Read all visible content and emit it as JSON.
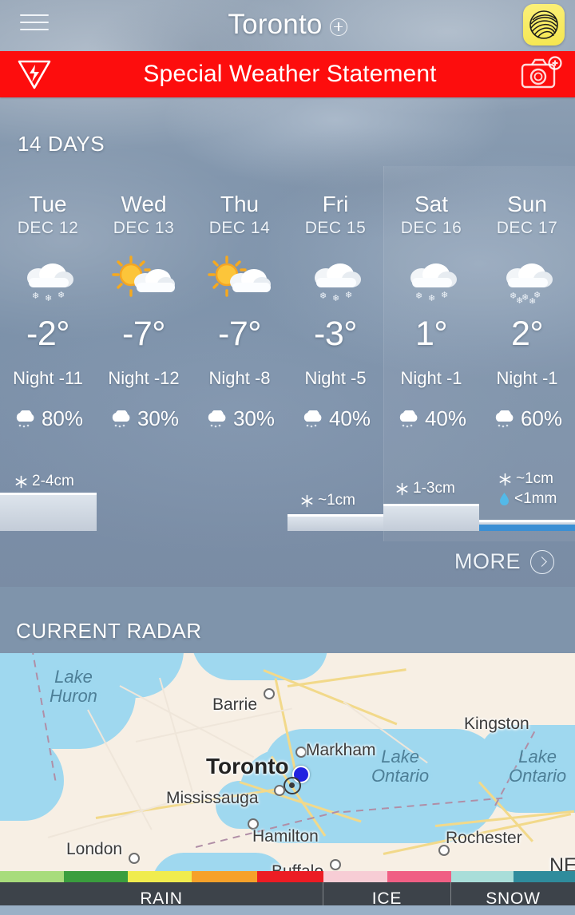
{
  "header": {
    "menu_icon": "hamburger-menu-icon",
    "city": "Toronto",
    "add_icon": "plus-circle-icon",
    "app_icon": "globe-sphere-icon"
  },
  "alert": {
    "icon": "lightning-triangle-icon",
    "text": "Special Weather Statement",
    "camera_icon": "camera-plus-icon",
    "color": "#fd0d0d"
  },
  "forecast": {
    "title": "14 DAYS",
    "more_label": "MORE",
    "more_icon": "chevron-right-circle-icon",
    "days": [
      {
        "dow": "Tue",
        "date": "DEC 12",
        "icon": "cloud-snow-icon",
        "high": "-2°",
        "night": "Night -11",
        "pop": "80%",
        "pop_icon": "cloud-drizzle-icon"
      },
      {
        "dow": "Wed",
        "date": "DEC 13",
        "icon": "sun-cloud-icon",
        "high": "-7°",
        "night": "Night -12",
        "pop": "30%",
        "pop_icon": "cloud-drizzle-icon"
      },
      {
        "dow": "Thu",
        "date": "DEC 14",
        "icon": "sun-cloud-icon",
        "high": "-7°",
        "night": "Night -8",
        "pop": "30%",
        "pop_icon": "cloud-drizzle-icon"
      },
      {
        "dow": "Fri",
        "date": "DEC 15",
        "icon": "cloud-snow-icon",
        "high": "-3°",
        "night": "Night -5",
        "pop": "40%",
        "pop_icon": "cloud-drizzle-icon"
      },
      {
        "dow": "Sat",
        "date": "DEC 16",
        "icon": "cloud-snow-icon",
        "high": "1°",
        "night": "Night -1",
        "pop": "40%",
        "pop_icon": "cloud-drizzle-icon"
      },
      {
        "dow": "Sun",
        "date": "DEC 17",
        "icon": "cloud-snow-icon",
        "high": "2°",
        "night": "Night -1",
        "pop": "60%",
        "pop_icon": "cloud-drizzle-icon"
      }
    ],
    "accumulation": [
      {
        "day_index": 0,
        "snow": "2-4cm",
        "rain": null
      },
      {
        "day_index": 3,
        "snow": "~1cm",
        "rain": null
      },
      {
        "day_index": 4,
        "snow": "1-3cm",
        "rain": null
      },
      {
        "day_index": 5,
        "snow": "~1cm",
        "rain": "<1mm"
      }
    ]
  },
  "radar": {
    "title": "CURRENT RADAR",
    "cities": [
      {
        "name": "Barrie",
        "style": "normal"
      },
      {
        "name": "Markham",
        "style": "normal"
      },
      {
        "name": "Kingston",
        "style": "normal"
      },
      {
        "name": "Toronto",
        "style": "big"
      },
      {
        "name": "Mississauga",
        "style": "normal"
      },
      {
        "name": "Hamilton",
        "style": "normal"
      },
      {
        "name": "London",
        "style": "normal"
      },
      {
        "name": "Rochester",
        "style": "normal"
      },
      {
        "name": "Buffalo",
        "style": "normal"
      },
      {
        "name": "NE",
        "style": "normal"
      }
    ],
    "lakes": [
      {
        "line1": "Lake",
        "line2": "Huron"
      },
      {
        "line1": "Lake",
        "line2": "Ontario"
      },
      {
        "line1": "Lake",
        "line2": "Ontario"
      }
    ],
    "location_marker": "current-location-dot"
  },
  "legend": {
    "cells": [
      {
        "label": "RAIN"
      },
      {
        "label": "ICE"
      },
      {
        "label": "SNOW"
      }
    ],
    "swatches": [
      "#a8dc7c",
      "#3a9e3e",
      "#f0ec4e",
      "#f6a12a",
      "#ec1c24",
      "#f7cdd5",
      "#f05f84",
      "#a9ded9",
      "#2f8c9c"
    ]
  }
}
